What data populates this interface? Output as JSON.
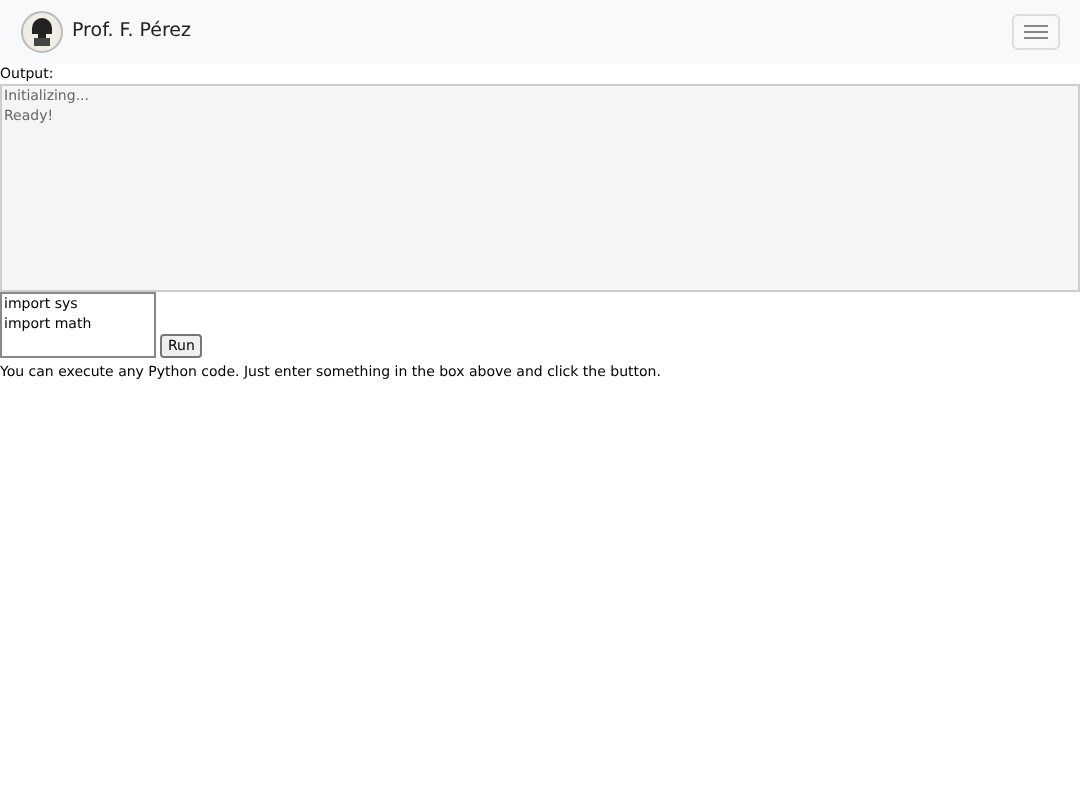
{
  "navbar": {
    "brand": "Prof. F. Pérez"
  },
  "output": {
    "label": "Output:",
    "lines": [
      "Initializing...",
      "Ready!"
    ]
  },
  "code_input": {
    "value": "import sys\nimport math"
  },
  "run_button": "Run",
  "help_text": "You can execute any Python code. Just enter something in the box above and click the button."
}
